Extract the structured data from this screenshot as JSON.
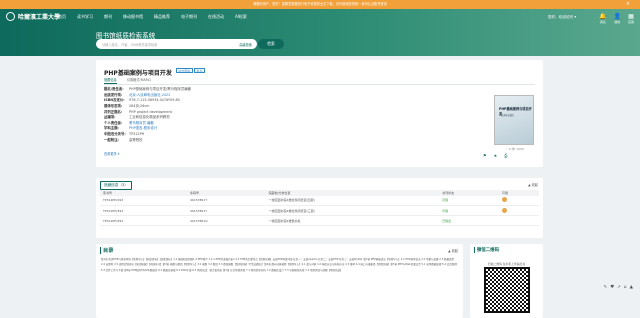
{
  "notice": {
    "text": "尊敬的用户，您好！如果您需要进行电子资源的全文下载，请先使用您的统一身份认证账号登录",
    "close": "×"
  },
  "header": {
    "logo_text": "哈爾濱工業大學",
    "nav": [
      "首页",
      "读书学习",
      "期刊",
      "移动图书馆",
      "精品推荐",
      "电子期刊",
      "在线活动",
      "AI检索"
    ],
    "user": "您好，欢迎访问 ▾",
    "icons": [
      {
        "icon": "bell-icon",
        "label": "消息"
      },
      {
        "icon": "user-icon",
        "label": "我的"
      },
      {
        "icon": "grid-icon",
        "label": "应用"
      }
    ]
  },
  "search": {
    "title": "图书馆纸质检索系统",
    "placeholder": "请输入题名、作者、ISBN等关键词检索",
    "advanced": "高级检索",
    "button": "检索"
  },
  "book": {
    "title": "PHP基础案例与项目开发",
    "badges": [
      "中文图书",
      "新书"
    ],
    "tabs": [
      "馆藏信息",
      "引用格式(MARC)"
    ],
    "fields": [
      {
        "k": "题名/责任者:",
        "v": "PHP基础案例与项目开发/黑马程序员编著"
      },
      {
        "k": "出版发行项:",
        "v": "北京:人民邮电出版社,2022"
      },
      {
        "k": "ISBN及定价:",
        "v": "978-7-115-58934-0/CNY59.80"
      },
      {
        "k": "载体形态项:",
        "v": "264页;26cm"
      },
      {
        "k": "并列正题名:",
        "v": "PHP project development"
      },
      {
        "k": "丛编项:",
        "v": "工业和信息化精品系列教材"
      },
      {
        "k": "个人责任者:",
        "v": "黑马程序员 编著"
      },
      {
        "k": "学科主题:",
        "v": "PHP语言-程序设计"
      },
      {
        "k": "中图法分类号:",
        "v": "TP312PH"
      },
      {
        "k": "一般附注:",
        "v": "高等院校"
      }
    ],
    "more": "查看更多 ▾",
    "cover_title": "PHP基础案例与项目开发",
    "cover_publisher": "人民邮电出版社",
    "stats": "♡ 0   👁 1005",
    "actions": [
      "⚑",
      "★",
      "⎙"
    ]
  },
  "holdings": {
    "tab": "馆藏信息（3）",
    "collapse": "▲ 收起",
    "columns": [
      "索书号",
      "条码号",
      "馆藏地/分类位置",
      "书刊状态",
      "可借"
    ],
    "rows": [
      {
        "call": "TP312PH/493",
        "barcode": "40157861T",
        "location": "一校区图书馆4楼社科阅览室(四层)",
        "status": "可借"
      },
      {
        "call": "TP312PH/493",
        "barcode": "40157861Y",
        "location": "一校区图书馆4楼社科阅览室(三层)",
        "status": "可借"
      },
      {
        "call": "TP312PH/493",
        "barcode": "40157861Q",
        "location": "一校区图书馆4楼借书处",
        "status": "已借出"
      }
    ]
  },
  "toc": {
    "title": "目录",
    "collapse": "▲ 收起",
    "body": "第1章 初识PHP与开发环境【项目导入】【知识目标】【技能目标】1.1 基础知识回顾1.2 PHP简介 1.2.1 PHP的发展历史1.2.2 PHP的主要特点【案例实施】安装PHP开发环境 任务一：安装Apache 任务二：安装PHP 任务三：安装MySQL 第2章 PHP基础语法【项目导入】2.1 PHP基本语法 2.2 常量与变量 2.3 数据类型 2.4 运算符 2.5 流程控制语句【知识拓展】【巩固练习】第3章 函数与数组【项目导入】3.1 函数 3.2 数组 3.3 数组函数【案例实施】学生成绩统计 第4章 面向对象编程【项目导入】4.1 类与对象 4.2 构造方法与析构方法 4.3 继承 4.4 接口与抽象类【项目实施】第5章 PHP与Web页面交互 5.1 表单数据处理 5.2 会话管理 5.3 文件上传与下载 第6章 PHP操作MySQL数据库 6.1 数据库基础 6.2 PDO扩展 6.3 项目实战：留言板系统 第7章 综合项目开发 7.1 项目需求分析 7.2 数据库设计 7.3 功能模块实现 7.4 项目测试与部署【项目总结】"
  },
  "qr": {
    "title": "微信二维码",
    "caption": "扫描二维码 在手机上查看此书"
  },
  "float_tools": [
    "✎",
    "♥",
    "↗",
    "⌂",
    "▲"
  ]
}
